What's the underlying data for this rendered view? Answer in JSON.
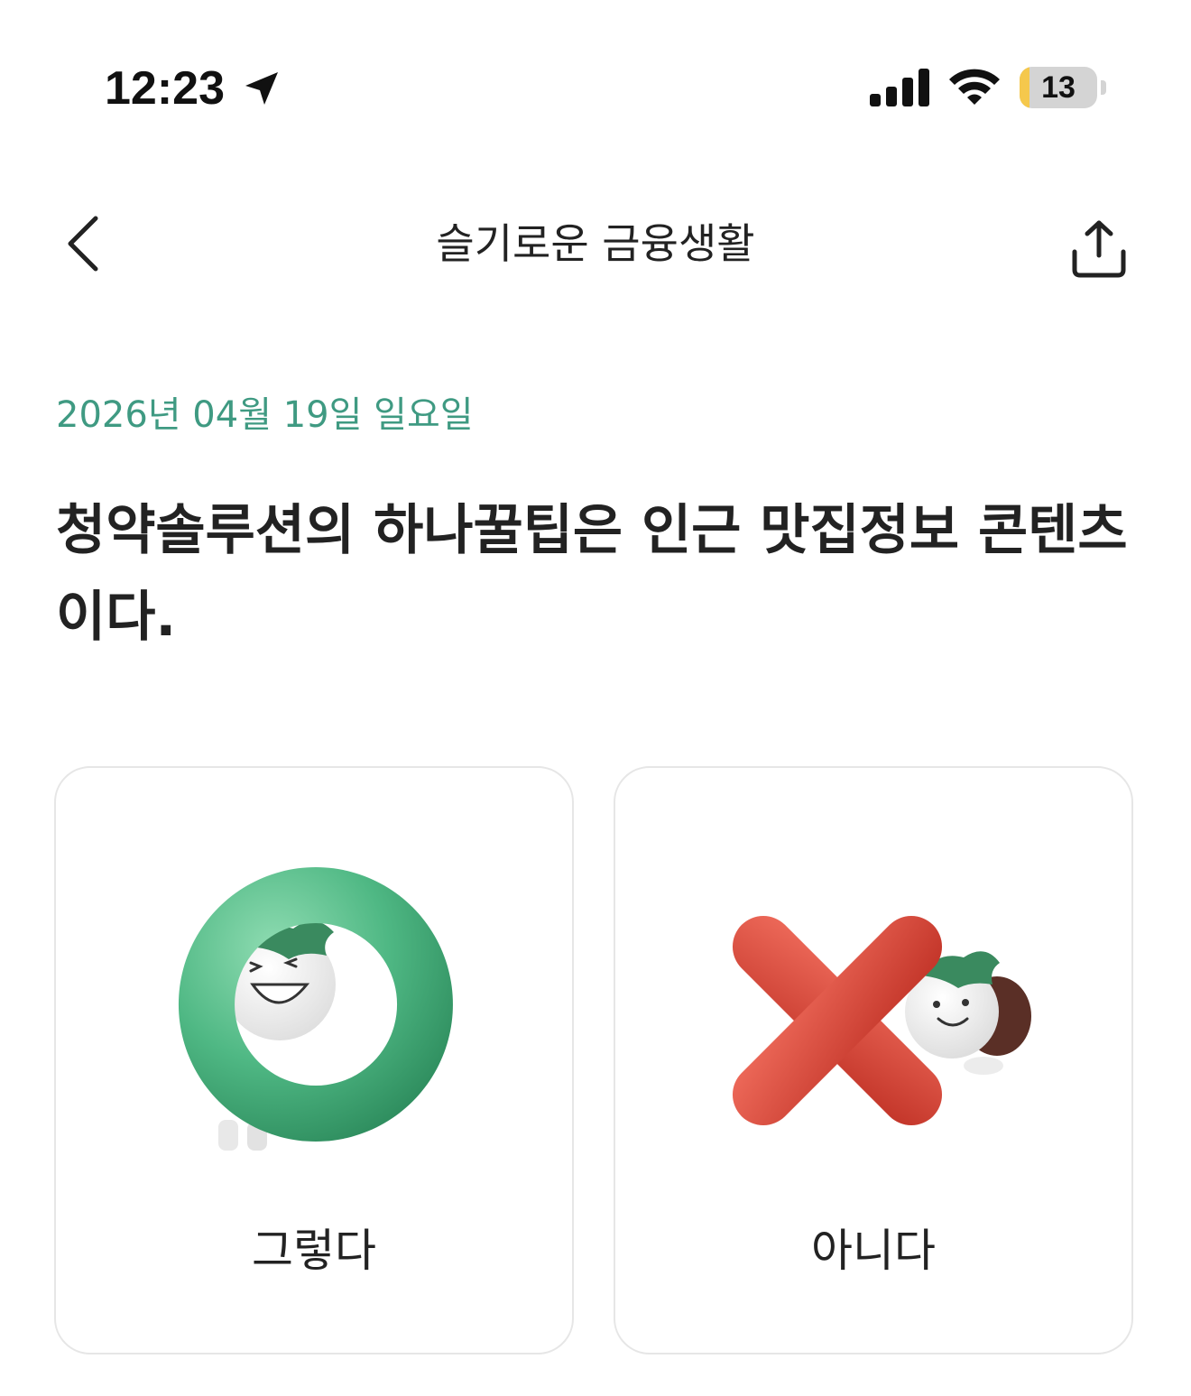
{
  "status_bar": {
    "time": "12:23",
    "battery_level": "13",
    "battery_percent": 13,
    "icons": [
      "location-arrow-icon",
      "cellular-signal-icon",
      "wifi-icon",
      "battery-icon"
    ]
  },
  "nav": {
    "title": "슬기로운 금융생활",
    "back_icon": "chevron-left-icon",
    "share_icon": "share-icon"
  },
  "content": {
    "date": "2026년 04월 19일 일요일",
    "question": "청약솔루션의 하나꿀팁은 인근 맛집정보 콘텐츠이다.",
    "choices": [
      {
        "label": "그렇다",
        "icon": "o-ring-character-icon",
        "color": "#4fb884"
      },
      {
        "label": "아니다",
        "icon": "x-mark-character-icon",
        "color": "#d8473a"
      }
    ]
  },
  "colors": {
    "accent": "#3f9a82",
    "text": "#222222",
    "card_border": "#e6e6e6",
    "battery_low": "#f5c84c"
  }
}
